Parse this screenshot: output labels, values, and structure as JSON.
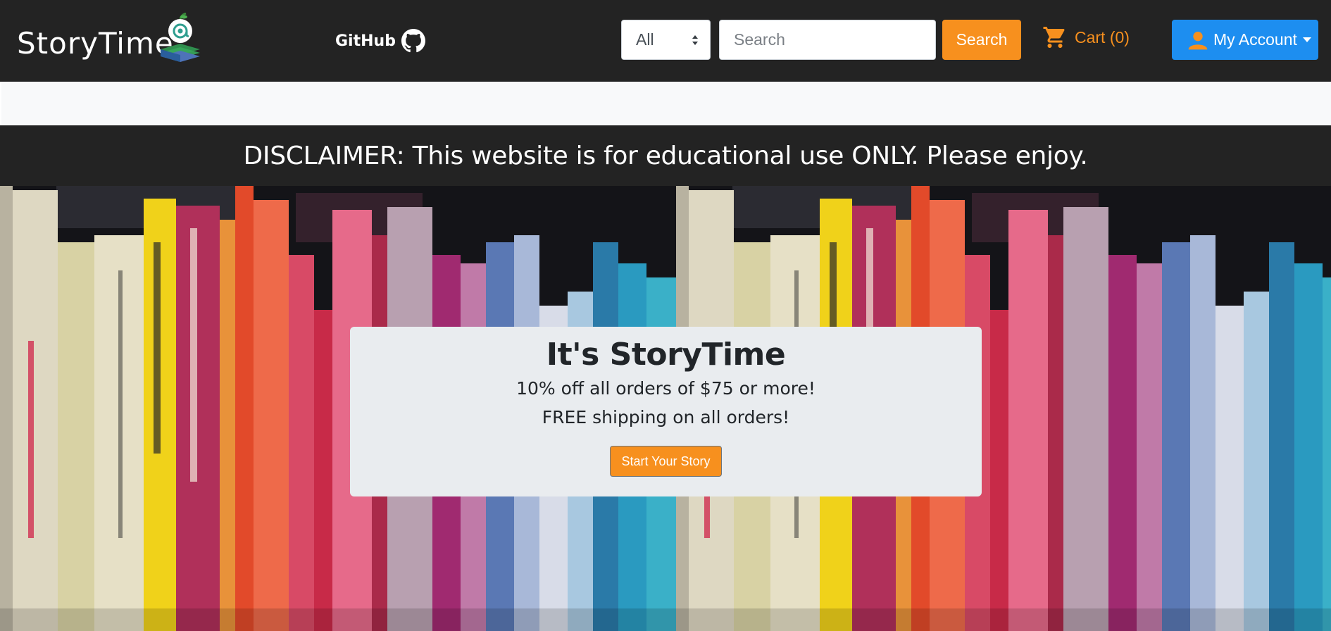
{
  "navbar": {
    "brand": "StoryTime",
    "github_label": "GitHub",
    "category_select": {
      "selected": "All"
    },
    "search": {
      "placeholder": "Search",
      "value": "",
      "button_label": "Search"
    },
    "cart_label": "Cart (0)",
    "account_label": "My Account"
  },
  "disclaimer": "DISCLAIMER: This website is for educational use ONLY. Please enjoy.",
  "hero": {
    "title": "It's StoryTime",
    "line1": "10% off all orders of $75 or more!",
    "line2": "FREE shipping on all orders!",
    "cta_label": "Start Your Story"
  },
  "colors": {
    "navbar_bg": "#232323",
    "accent_orange": "#f7901e",
    "account_blue": "#1d8ef0",
    "card_bg": "#e9ecef"
  },
  "icons": [
    "brand-logo-icon",
    "github-icon",
    "select-caret-icon",
    "cart-icon",
    "user-icon",
    "dropdown-caret-icon"
  ]
}
